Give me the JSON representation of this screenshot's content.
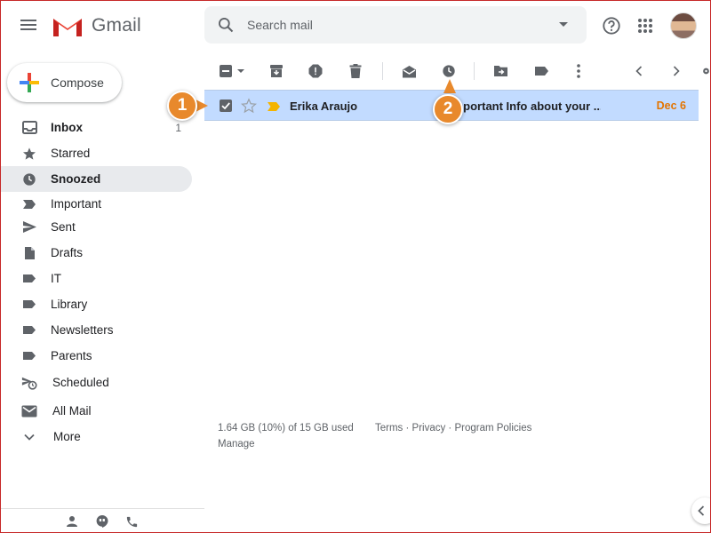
{
  "app": {
    "logo_text": "Gmail"
  },
  "search": {
    "placeholder": "Search mail"
  },
  "compose": {
    "label": "Compose"
  },
  "sidebar": {
    "items": [
      {
        "label": "Inbox",
        "count": "1",
        "icon": "inbox-icon"
      },
      {
        "label": "Starred",
        "count": "",
        "icon": "star-icon"
      },
      {
        "label": "Snoozed",
        "count": "",
        "icon": "clock-icon"
      },
      {
        "label": "Important",
        "count": "",
        "icon": "important-icon"
      },
      {
        "label": "Sent",
        "count": "",
        "icon": "send-icon"
      },
      {
        "label": "Drafts",
        "count": "",
        "icon": "draft-icon"
      },
      {
        "label": "IT",
        "count": "",
        "icon": "label-icon"
      },
      {
        "label": "Library",
        "count": "",
        "icon": "label-icon"
      },
      {
        "label": "Newsletters",
        "count": "",
        "icon": "label-icon"
      },
      {
        "label": "Parents",
        "count": "",
        "icon": "label-icon"
      },
      {
        "label": "Scheduled",
        "count": "",
        "icon": "scheduled-icon"
      },
      {
        "label": "All Mail",
        "count": "",
        "icon": "mail-icon"
      },
      {
        "label": "More",
        "count": "",
        "icon": "chevron-down-icon"
      }
    ],
    "active": "Snoozed"
  },
  "email": {
    "sender": "Erika Araujo",
    "subject": "Important Info about your ...",
    "date": "Dec 6",
    "selected": true
  },
  "footer": {
    "storage": "1.64 GB (10%) of 15 GB used",
    "manage": "Manage",
    "links": "Terms · Privacy · Program Policies"
  },
  "callouts": {
    "one": "1",
    "two": "2"
  },
  "colors": {
    "accent": "#e8892c",
    "selected_row": "#c2dbff",
    "date": "#e37400",
    "active_nav": "#e8eaed"
  }
}
